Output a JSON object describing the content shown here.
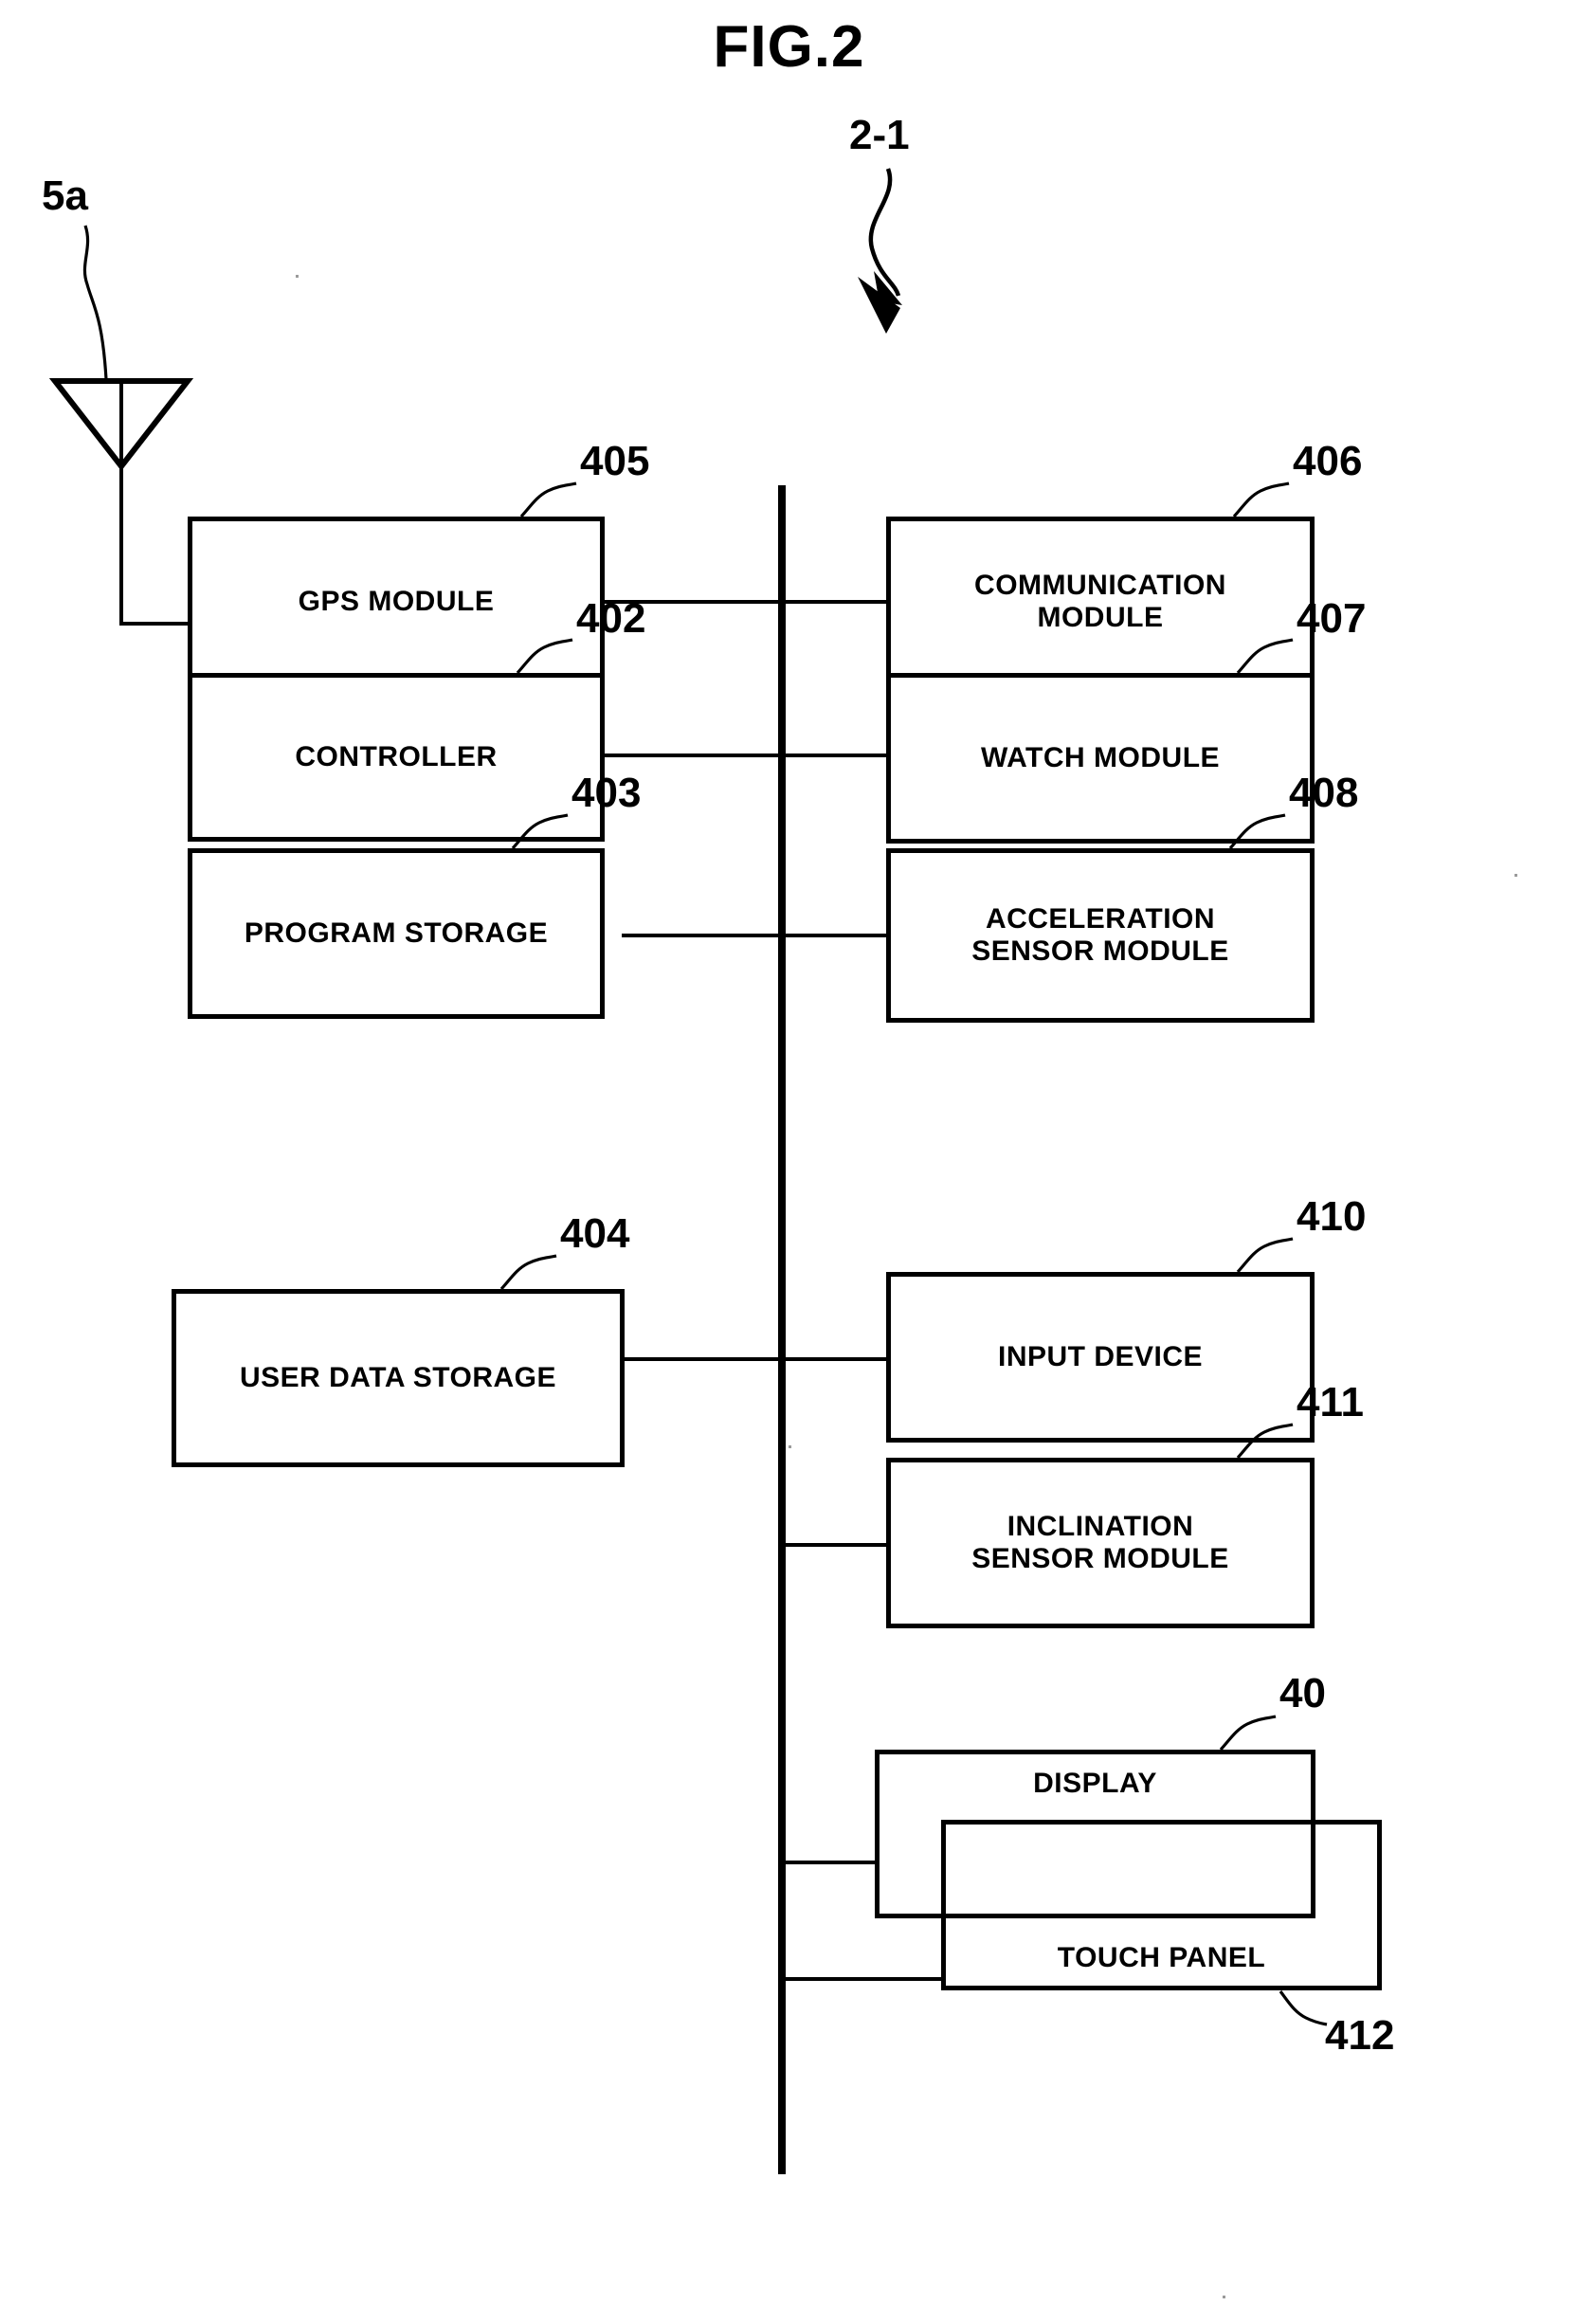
{
  "figure": {
    "title": "FIG.2",
    "system_ref": "2-1",
    "antenna_ref": "5a"
  },
  "blocks": {
    "left": [
      {
        "label": "GPS MODULE",
        "ref": "405"
      },
      {
        "label": "CONTROLLER",
        "ref": "402"
      },
      {
        "label": "PROGRAM STORAGE",
        "ref": "403"
      },
      {
        "label": "USER DATA STORAGE",
        "ref": "404"
      }
    ],
    "right": [
      {
        "label_line1": "COMMUNICATION",
        "label_line2": "MODULE",
        "ref": "406"
      },
      {
        "label_line1": "WATCH MODULE",
        "label_line2": "",
        "ref": "407"
      },
      {
        "label_line1": "ACCELERATION",
        "label_line2": "SENSOR MODULE",
        "ref": "408"
      },
      {
        "label_line1": "INPUT DEVICE",
        "label_line2": "",
        "ref": "410"
      },
      {
        "label_line1": "INCLINATION",
        "label_line2": "SENSOR MODULE",
        "ref": "411"
      }
    ],
    "overlay": [
      {
        "label": "DISPLAY",
        "ref": "40"
      },
      {
        "label": "TOUCH PANEL",
        "ref": "412"
      }
    ]
  },
  "colors": {
    "ink": "#000000",
    "paper": "#ffffff"
  }
}
